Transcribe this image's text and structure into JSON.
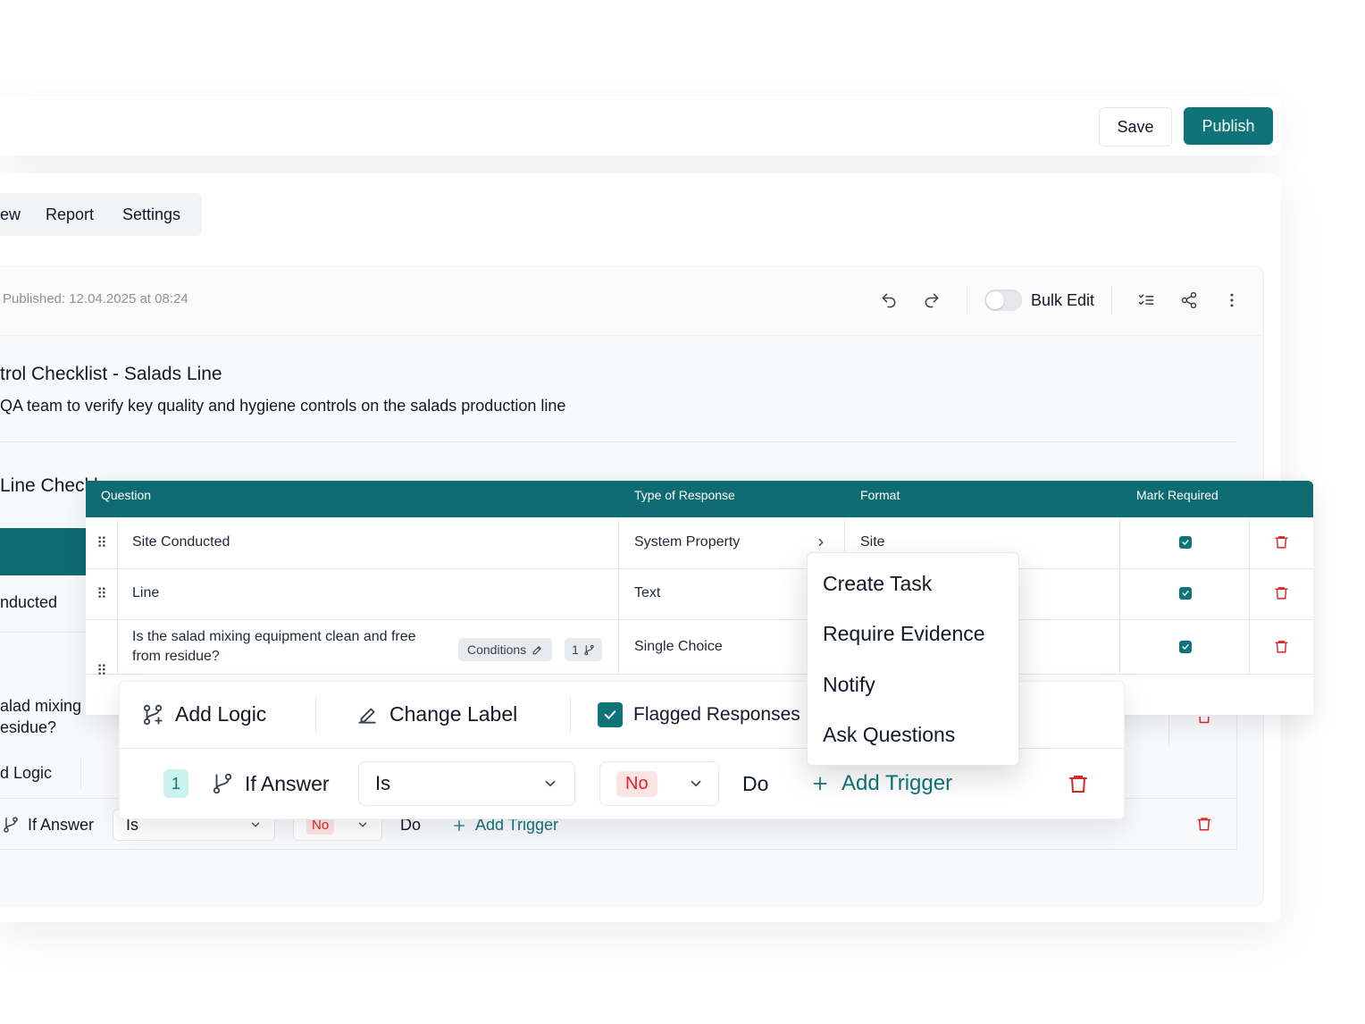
{
  "header": {
    "save_label": "Save",
    "publish_label": "Publish"
  },
  "tabs": [
    {
      "label": "ew"
    },
    {
      "label": "Report"
    },
    {
      "label": "Settings"
    }
  ],
  "toolbar": {
    "published_text": "Published: 12.04.2025 at 08:24",
    "bulk_edit_label": "Bulk Edit",
    "icons": [
      "undo-icon",
      "redo-icon",
      "checklist-icon",
      "share-icon",
      "more-vertical-icon"
    ]
  },
  "checklist": {
    "title": "trol Checklist - Salads Line",
    "description": "QA team to verify key quality and hygiene controls on the salads production line"
  },
  "section": {
    "title": "Line Checkl"
  },
  "background_rows": {
    "row2_question": "nducted",
    "row3_question_line1": "alad mixing",
    "row3_question_line2": "esidue?",
    "add_logic_label": "d Logic",
    "if_answer_label": "If Answer",
    "is_value": "Is",
    "no_value": "No",
    "do_label": "Do",
    "add_trigger_label": "Add Trigger"
  },
  "table": {
    "columns": [
      "Question",
      "Type of Response",
      "Format",
      "Mark Required"
    ],
    "rows": [
      {
        "question": "Site Conducted",
        "type": "System Property",
        "format": "Site",
        "required": true
      },
      {
        "question": "Line",
        "type": "Text",
        "format": "",
        "required": true
      },
      {
        "question_line1": "Is the salad mixing equipment clean and free",
        "question_line2": "from residue?",
        "type": "Single Choice",
        "format": "",
        "required": true,
        "conditions_label": "Conditions",
        "branch_count": "1"
      }
    ]
  },
  "logic_panel": {
    "add_logic_label": "Add Logic",
    "change_label_label": "Change Label",
    "flagged_label": "Flagged Responses",
    "flagged_checked": true,
    "rule_number": "1",
    "if_answer_label": "If Answer",
    "operator_value": "Is",
    "answer_value": "No",
    "do_label": "Do",
    "add_trigger_label": "Add Trigger"
  },
  "trigger_menu": {
    "items": [
      "Create Task",
      "Require Evidence",
      "Notify",
      "Ask Questions"
    ]
  },
  "colors": {
    "brand_teal": "#0e7479",
    "table_header": "#0e6b72",
    "danger": "#dc2626",
    "danger_bg": "#fde4e4",
    "badge_bg": "#ccf2ee"
  }
}
